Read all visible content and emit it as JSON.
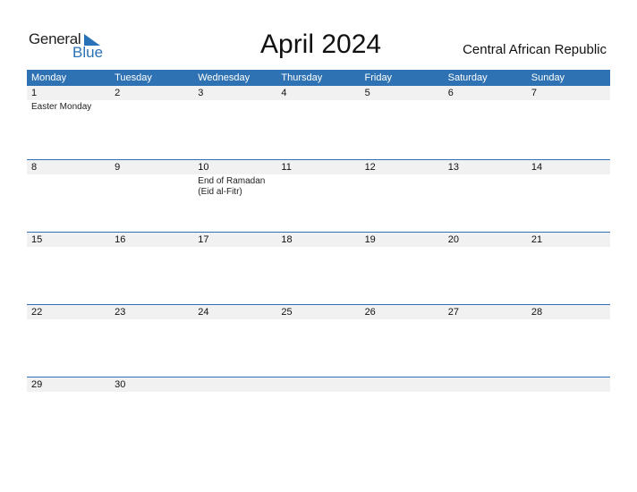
{
  "logo": {
    "word1": "General",
    "word2": "Blue"
  },
  "title": "April 2024",
  "country": "Central African Republic",
  "colors": {
    "accent": "#2e72b4",
    "row_bg": "#f1f1f1"
  },
  "weekdays": [
    "Monday",
    "Tuesday",
    "Wednesday",
    "Thursday",
    "Friday",
    "Saturday",
    "Sunday"
  ],
  "weeks": [
    {
      "days": [
        {
          "n": "1",
          "ev": "Easter Monday"
        },
        {
          "n": "2",
          "ev": ""
        },
        {
          "n": "3",
          "ev": ""
        },
        {
          "n": "4",
          "ev": ""
        },
        {
          "n": "5",
          "ev": ""
        },
        {
          "n": "6",
          "ev": ""
        },
        {
          "n": "7",
          "ev": ""
        }
      ]
    },
    {
      "days": [
        {
          "n": "8",
          "ev": ""
        },
        {
          "n": "9",
          "ev": ""
        },
        {
          "n": "10",
          "ev": "End of Ramadan (Eid al-Fitr)"
        },
        {
          "n": "11",
          "ev": ""
        },
        {
          "n": "12",
          "ev": ""
        },
        {
          "n": "13",
          "ev": ""
        },
        {
          "n": "14",
          "ev": ""
        }
      ]
    },
    {
      "days": [
        {
          "n": "15",
          "ev": ""
        },
        {
          "n": "16",
          "ev": ""
        },
        {
          "n": "17",
          "ev": ""
        },
        {
          "n": "18",
          "ev": ""
        },
        {
          "n": "19",
          "ev": ""
        },
        {
          "n": "20",
          "ev": ""
        },
        {
          "n": "21",
          "ev": ""
        }
      ]
    },
    {
      "days": [
        {
          "n": "22",
          "ev": ""
        },
        {
          "n": "23",
          "ev": ""
        },
        {
          "n": "24",
          "ev": ""
        },
        {
          "n": "25",
          "ev": ""
        },
        {
          "n": "26",
          "ev": ""
        },
        {
          "n": "27",
          "ev": ""
        },
        {
          "n": "28",
          "ev": ""
        }
      ]
    },
    {
      "days": [
        {
          "n": "29",
          "ev": ""
        },
        {
          "n": "30",
          "ev": ""
        },
        {
          "n": "",
          "ev": ""
        },
        {
          "n": "",
          "ev": ""
        },
        {
          "n": "",
          "ev": ""
        },
        {
          "n": "",
          "ev": ""
        },
        {
          "n": "",
          "ev": ""
        }
      ]
    }
  ]
}
